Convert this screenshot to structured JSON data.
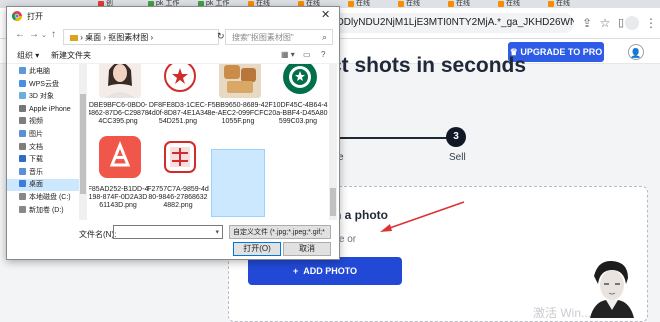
{
  "browser": {
    "tabs": [
      {
        "label": "创",
        "color": "#e53935"
      },
      {
        "label": "pk 工作",
        "color": "#43a047"
      },
      {
        "label": "pk 工作",
        "color": "#43a047"
      },
      {
        "label": "在线",
        "color": "#fb8c00"
      },
      {
        "label": "在线",
        "color": "#fb8c00"
      },
      {
        "label": "在线",
        "color": "#fb8c00"
      },
      {
        "label": "在线",
        "color": "#fb8c00"
      },
      {
        "label": "在线",
        "color": "#fb8c00"
      },
      {
        "label": "在线",
        "color": "#fb8c00"
      },
      {
        "label": "在线",
        "color": "#fb8c00"
      }
    ],
    "url": "ODlyNDU2NjM1LjE3MTI0NTY2MjA.*_ga_JKHD26WN...",
    "icons": [
      "share-icon",
      "star-icon",
      "extensions-icon",
      "sidebar-icon",
      "profile-icon",
      "menu-icon"
    ]
  },
  "site": {
    "upgrade_label": "UPGRADE TO PRO",
    "hero_text": "ct shots in seconds",
    "step_number": "3",
    "step_partial_label": "e",
    "step_label": "Sell",
    "drop_title": "th a photo",
    "drop_subtitle": "ere or",
    "add_photo_label": "ADD PHOTO",
    "add_photo_icon": "+",
    "watermark": "激活 Win..."
  },
  "dialog": {
    "title": "打开",
    "breadcrumb": [
      "桌面",
      "抠图素材图"
    ],
    "search_placeholder": "搜索\"抠图素材图\"",
    "new_folder_label": "新建文件夹",
    "organize_label": "组织 ▾",
    "tree": [
      {
        "label": "此电脑",
        "icon_color": "#5b9bd5"
      },
      {
        "label": "WPS云盘",
        "icon_color": "#4a90e2"
      },
      {
        "label": "3D 对象",
        "icon_color": "#6aaee0"
      },
      {
        "label": "Apple iPhone",
        "icon_color": "#777777"
      },
      {
        "label": "视频",
        "icon_color": "#7e7e7e"
      },
      {
        "label": "图片",
        "icon_color": "#5c8fd6"
      },
      {
        "label": "文档",
        "icon_color": "#7e7e7e"
      },
      {
        "label": "下载",
        "icon_color": "#2f6fc3"
      },
      {
        "label": "音乐",
        "icon_color": "#5c8fd6"
      },
      {
        "label": "桌面",
        "icon_color": "#3b7ddd"
      },
      {
        "label": "本地磁盘 (C:)",
        "icon_color": "#888888"
      },
      {
        "label": "新加卷 (D:)",
        "icon_color": "#888888"
      }
    ],
    "selected_tree_index": 9,
    "files": [
      {
        "name": "DBE9BFC6-0BD0-4862-87D6-C298784CC395.png",
        "thumb": "woman-photo"
      },
      {
        "name": "DF8FE8D3-1CEC-4d0f-8D87-4E1A3454D251.png",
        "thumb": "red-stamp"
      },
      {
        "name": "F5BB9650-8689-428e-AEC2-099FCFC1055F.png",
        "thumb": "bread-photo"
      },
      {
        "name": "F10DF45C-4B64-420a-BBF4-D45A80599C03.png",
        "thumb": "starbucks-logo"
      },
      {
        "name": "F85AD252-B1DD-4198-874F-0D2A3D61143D.png",
        "thumb": "red-app-icon"
      },
      {
        "name": "F2757C7A-9859-4d80-9846-278686324882.png",
        "thumb": "red-seal"
      }
    ],
    "filename_label": "文件名(N):",
    "filename_value": "",
    "filetype_value": "自定义文件 (*.jpg;*.jpeg;*.gif;*",
    "open_label": "打开(O)",
    "cancel_label": "取消"
  }
}
